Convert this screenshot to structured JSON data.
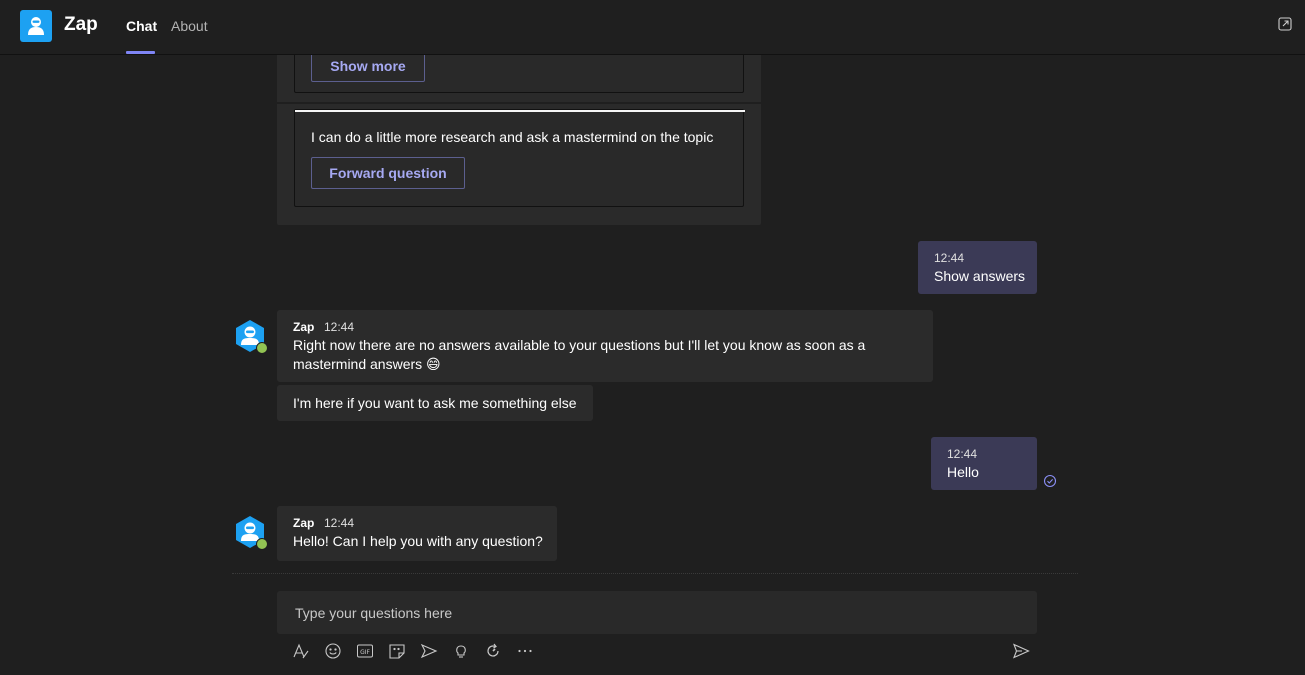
{
  "header": {
    "app_title": "Zap",
    "tabs": [
      {
        "label": "Chat",
        "active": true
      },
      {
        "label": "About",
        "active": false
      }
    ],
    "accent": "#7f85f5",
    "icon_color": "#1da1f2"
  },
  "card": {
    "show_more_label": "Show more",
    "research_text": "I can do a little more research and ask a mastermind on the topic",
    "forward_label": "Forward question"
  },
  "messages": {
    "me_1": {
      "time": "12:44",
      "text": "Show answers"
    },
    "bot_1": {
      "name": "Zap",
      "time": "12:44",
      "text": "Right now there are no answers available to your questions but I'll let you know as soon as a mastermind answers 😄",
      "followup": "I'm here if you want to ask me something else"
    },
    "me_2": {
      "time": "12:44",
      "text": "Hello"
    },
    "bot_2": {
      "name": "Zap",
      "time": "12:44",
      "text": "Hello! Can I help you with any question?"
    }
  },
  "compose": {
    "placeholder": "Type your questions here",
    "tools": [
      "format-icon",
      "emoji-icon",
      "gif-icon",
      "sticker-icon",
      "meet-icon",
      "praise-icon",
      "loop-icon",
      "more-icon"
    ]
  },
  "colors": {
    "background": "#1f1f1f",
    "my_bubble": "#3b3a56",
    "bot_bubble": "#2b2b2b",
    "presence": "#92c353"
  }
}
